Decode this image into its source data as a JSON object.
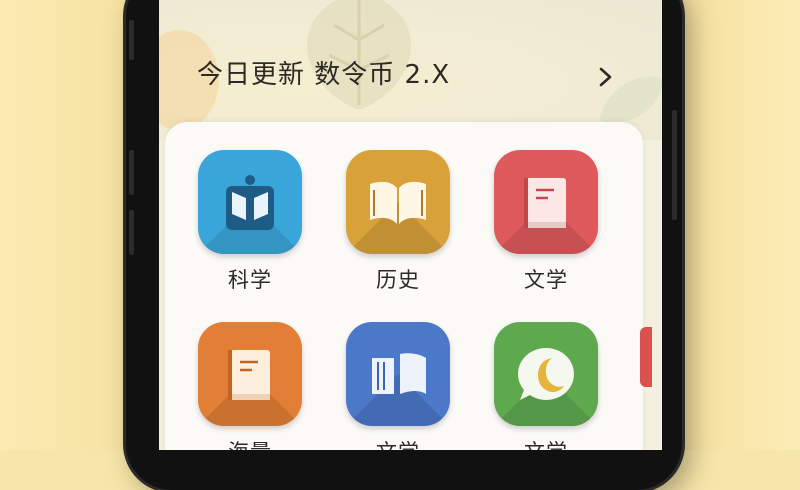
{
  "banner": {
    "text": "今日更新 数令币 2.X"
  },
  "apps": [
    {
      "label": "科学",
      "icon": "science-book-icon",
      "color": "#3aa5d8"
    },
    {
      "label": "历史",
      "icon": "open-book-icon",
      "color": "#d9a13a"
    },
    {
      "label": "文学",
      "icon": "closed-book-icon",
      "color": "#de5a5d"
    },
    {
      "label": "海量",
      "icon": "closed-book-icon",
      "color": "#e27e36"
    },
    {
      "label": "文学",
      "icon": "open-book-icon",
      "color": "#4b78c9"
    },
    {
      "label": "文学",
      "icon": "chat-moon-icon",
      "color": "#5ea94e"
    }
  ]
}
